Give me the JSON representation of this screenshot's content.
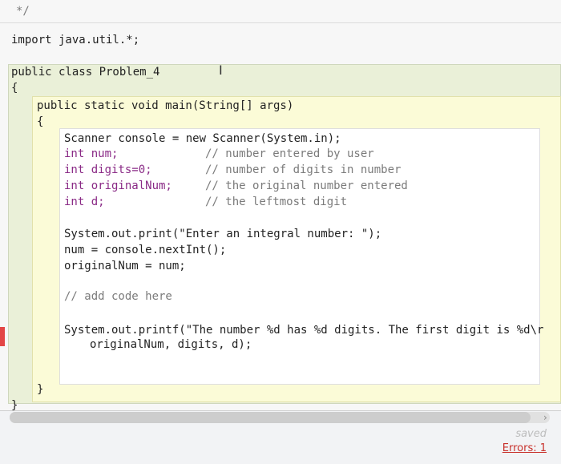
{
  "code": {
    "comment_end": "*/",
    "import": "import java.util.*;",
    "class_decl": "public class Problem_4",
    "brace_open": "{",
    "method_decl": "public static void main(String[] args)",
    "method_brace_open": "{",
    "lines": [
      "Scanner console = new Scanner(System.in);",
      "int num;",
      "int digits=0;",
      "int originalNum;",
      "int d;",
      "System.out.print(\"Enter an integral number: \");",
      "num = console.nextInt();",
      "originalNum = num;",
      "// add code here",
      "System.out.printf(\"The number %d has %d digits. The first digit is %d\\r",
      "originalNum, digits, d);"
    ],
    "comments": [
      "// number entered by user",
      "// number of digits in number",
      "// the original number entered",
      "// the leftmost digit"
    ],
    "method_brace_close": "}",
    "class_brace_close": "}"
  },
  "status": {
    "saved": "saved",
    "errors": "Errors: 1"
  },
  "icons": {
    "text_cursor": "I",
    "scroll_right": "›"
  }
}
